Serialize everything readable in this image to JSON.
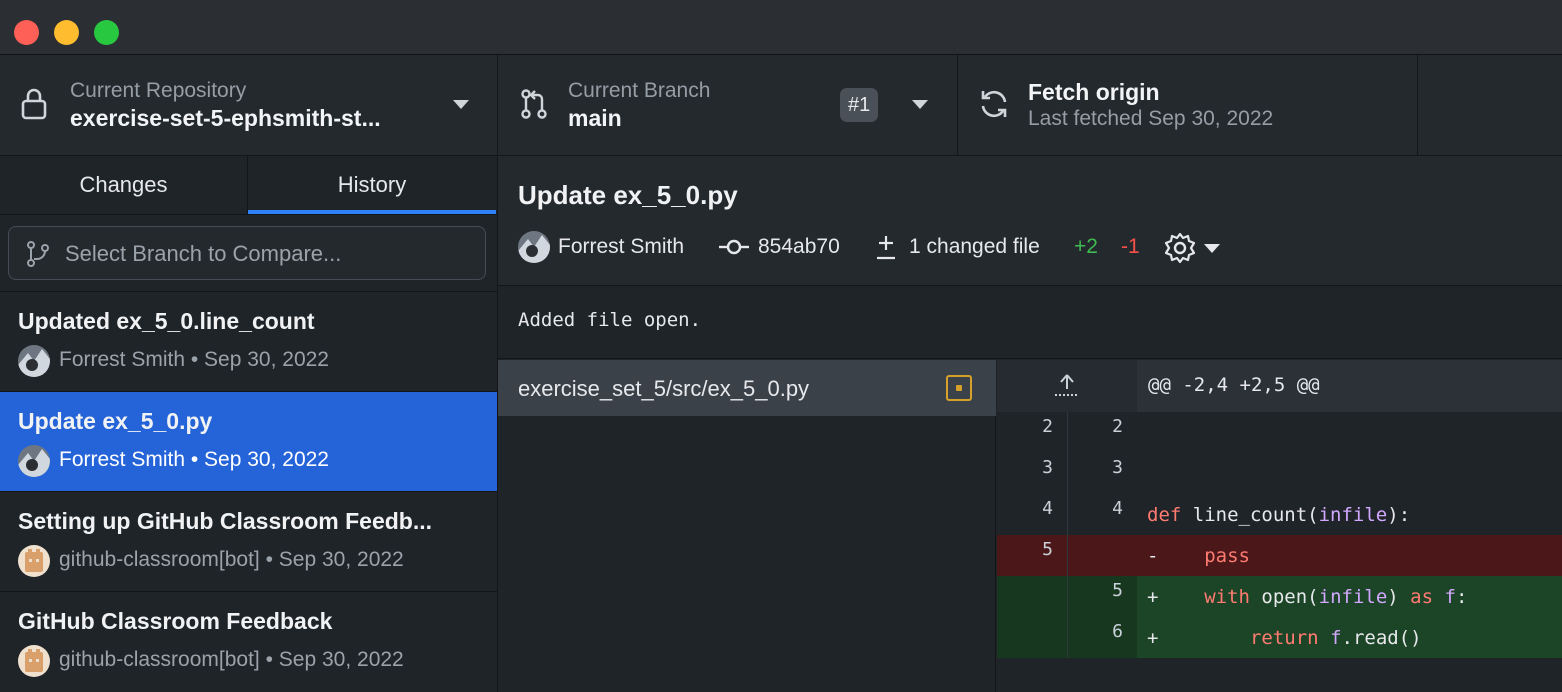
{
  "titlebar": {
    "buttons": [
      "close",
      "minimize",
      "zoom"
    ]
  },
  "toolbar": {
    "repo_label": "Current Repository",
    "repo_value": "exercise-set-5-ephsmith-st...",
    "branch_label": "Current Branch",
    "branch_value": "main",
    "pr_badge": "#1",
    "fetch_title": "Fetch origin",
    "fetch_subtitle": "Last fetched Sep 30, 2022"
  },
  "sidebar": {
    "tabs": [
      {
        "label": "Changes",
        "active": false
      },
      {
        "label": "History",
        "active": true
      }
    ],
    "compare_placeholder": "Select Branch to Compare...",
    "commits": [
      {
        "title": "Updated ex_5_0.line_count",
        "author": "Forrest Smith",
        "date": "Sep 30, 2022",
        "meta": "Forrest Smith • Sep 30, 2022",
        "selected": false
      },
      {
        "title": "Update ex_5_0.py",
        "author": "Forrest Smith",
        "date": "Sep 30, 2022",
        "meta": "Forrest Smith • Sep 30, 2022",
        "selected": true
      },
      {
        "title": "Setting up GitHub Classroom Feedb...",
        "author": "github-classroom[bot]",
        "date": "Sep 30, 2022",
        "meta": "github-classroom[bot] • Sep 30, 2022",
        "selected": false
      },
      {
        "title": "GitHub Classroom Feedback",
        "author": "github-classroom[bot]",
        "date": "Sep 30, 2022",
        "meta": "github-classroom[bot] • Sep 30, 2022",
        "selected": false
      }
    ]
  },
  "details": {
    "title": "Update ex_5_0.py",
    "author": "Forrest Smith",
    "sha": "854ab70",
    "changed_files": "1 changed file",
    "additions": "+2",
    "deletions": "-1",
    "message": "Added file open."
  },
  "files": [
    {
      "path": "exercise_set_5/src/ex_5_0.py",
      "status": "modified"
    }
  ],
  "diff": {
    "hunk_header": "@@ -2,4 +2,5 @@",
    "lines": [
      {
        "type": "context",
        "old": "2",
        "new": "2",
        "text": ""
      },
      {
        "type": "context",
        "old": "3",
        "new": "3",
        "text": ""
      },
      {
        "type": "context",
        "old": "4",
        "new": "4",
        "text": "def line_count(infile):"
      },
      {
        "type": "del",
        "old": "5",
        "new": "",
        "text": "-    pass"
      },
      {
        "type": "add",
        "old": "",
        "new": "5",
        "text": "+    with open(infile) as f:"
      },
      {
        "type": "add",
        "old": "",
        "new": "6",
        "text": "+        return f.read()"
      }
    ]
  },
  "colors": {
    "accent": "#2563d8",
    "additions": "#3fb950",
    "deletions": "#f85149",
    "modified": "#d6a12b"
  }
}
